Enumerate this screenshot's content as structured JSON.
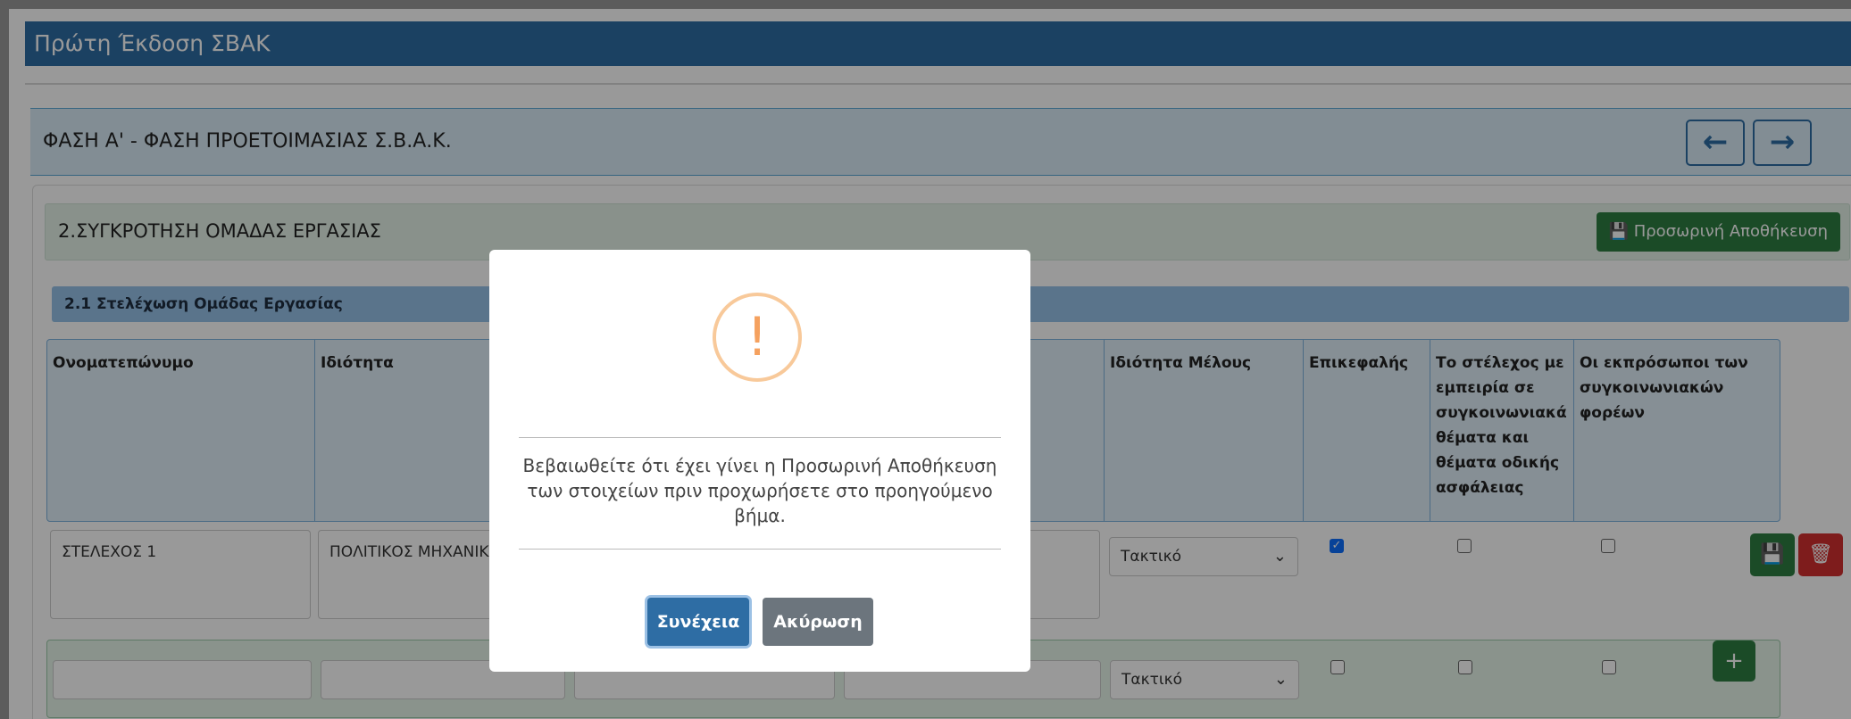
{
  "page": {
    "title": "Πρώτη Έκδοση ΣΒΑΚ"
  },
  "phase": {
    "title": "ΦΑΣΗ Α' - ΦΑΣΗ ΠΡΟΕΤΟΙΜΑΣΙΑΣ Σ.Β.Α.Κ.",
    "prev_icon": "arrow-left-icon",
    "next_icon": "arrow-right-icon"
  },
  "section": {
    "title": "2.ΣΥΓΚΡΟΤΗΣΗ ΟΜΑΔΑΣ ΕΡΓΑΣΙΑΣ",
    "save_label": "Προσωρινή Αποθήκευση"
  },
  "subsection": {
    "title": "2.1 Στελέχωση Ομάδας Εργασίας"
  },
  "table": {
    "columns": [
      "Ονοματεπώνυμο",
      "Ιδιότητα",
      "",
      "",
      "Ιδιότητα Μέλους",
      "Επικεφαλής",
      "Το στέλεχος με εμπειρία σε συγκοινωνιακά θέματα και θέματα οδικής ασφάλειας",
      "Οι εκπρόσωποι των συγκοινωνιακών φορέων"
    ],
    "rows": [
      {
        "name": "ΣΤΕΛΕΧΟΣ 1",
        "role": "ΠΟΛΙΤΙΚΟΣ ΜΗΧΑΝΙΚ",
        "member_type": "Τακτικό",
        "head": true,
        "expert": false,
        "representative": false
      }
    ],
    "new_row": {
      "member_type": "Τακτικό",
      "head": false,
      "expert": false,
      "representative": false
    }
  },
  "modal": {
    "message": "Βεβαιωθείτε ότι έχει γίνει η Προσωρινή Αποθήκευση των στοιχείων πριν προχωρήσετε στο προηγούμενο βήμα.",
    "confirm_label": "Συνέχεια",
    "cancel_label": "Ακύρωση",
    "icon": "!"
  },
  "colors": {
    "primary": "#2e6da4",
    "success": "#2e7d42",
    "danger": "#d32f2f",
    "warning": "#f8c99a"
  }
}
